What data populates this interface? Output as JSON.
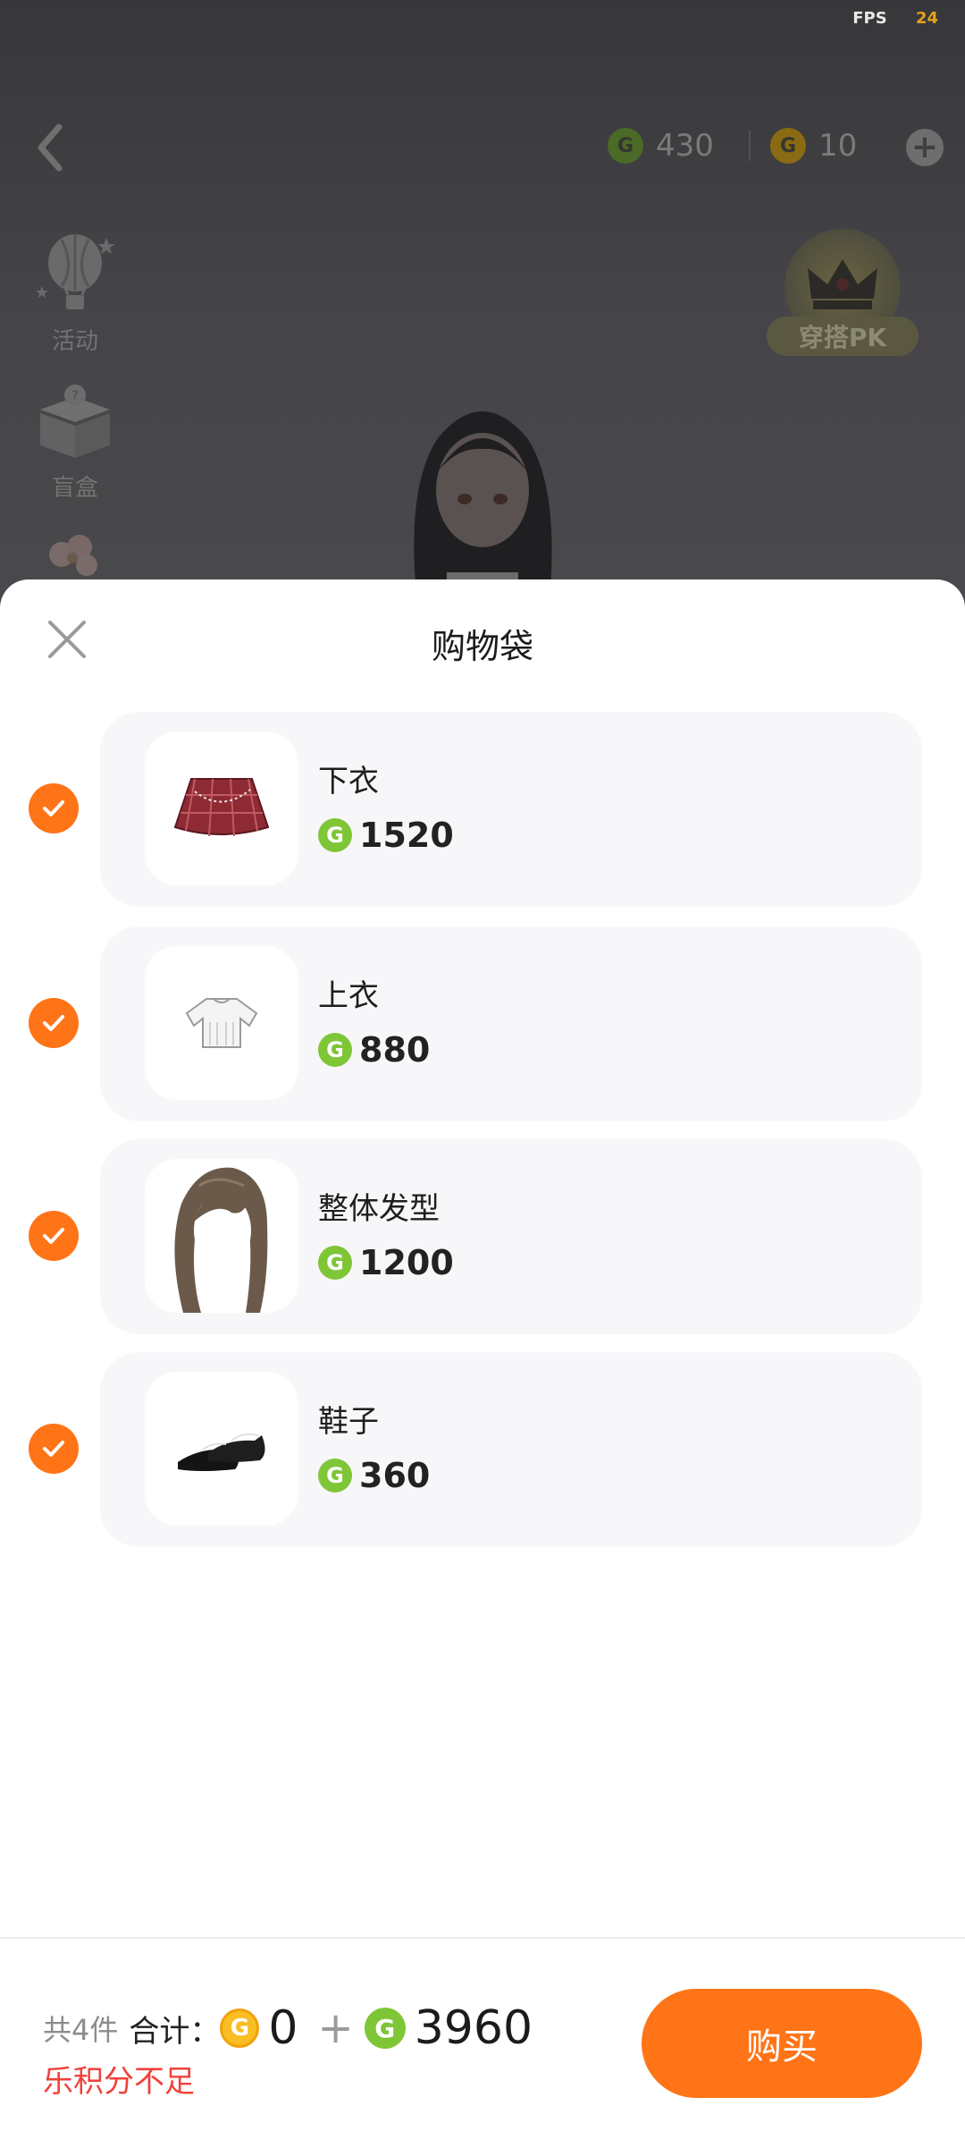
{
  "status": {
    "fps_label": "FPS",
    "fps_value": "24"
  },
  "topbar": {
    "currency_green": "430",
    "currency_orange": "10"
  },
  "sidebar": {
    "items": [
      {
        "label": "活动",
        "icon": "hot-air-balloon-icon"
      },
      {
        "label": "盲盒",
        "icon": "gift-box-icon"
      },
      {
        "label": "",
        "icon": "flower-icon"
      }
    ]
  },
  "pk_badge": {
    "label": "穿搭PK",
    "icon": "crown-icon"
  },
  "sheet": {
    "title": "购物袋",
    "items": [
      {
        "name": "下衣",
        "price": "1520",
        "thumb": "skirt",
        "checked": true
      },
      {
        "name": "上衣",
        "price": "880",
        "thumb": "top",
        "checked": true
      },
      {
        "name": "整体发型",
        "price": "1200",
        "thumb": "hair",
        "checked": true
      },
      {
        "name": "鞋子",
        "price": "360",
        "thumb": "shoes",
        "checked": true
      }
    ]
  },
  "footer": {
    "count_text": "共4件",
    "total_label": "合计：",
    "orange_total": "0",
    "plus": "+",
    "green_total": "3960",
    "warning": "乐积分不足",
    "buy_label": "购买"
  },
  "colors": {
    "accent": "#ff7417",
    "green_coin": "#7fc637",
    "orange_coin": "#f9be24",
    "warning": "#f0413a"
  }
}
